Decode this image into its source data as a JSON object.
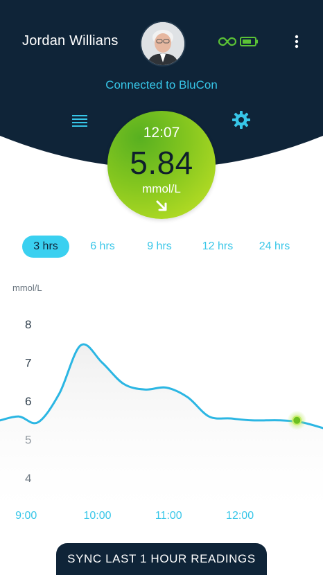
{
  "header": {
    "user_name": "Jordan Willians",
    "connection_status": "Connected to BluCon",
    "sensor_icon": "infinity-link-icon",
    "battery_icon": "battery-icon",
    "menu_icon": "menu-icon",
    "settings_icon": "gear-icon",
    "more_icon": "more-vertical-icon",
    "colors": {
      "background": "#0f2438",
      "accent": "#37c6e8",
      "status_green": "#5bc236"
    }
  },
  "reading": {
    "time": "12:07",
    "value": "5.84",
    "unit": "mmol/L",
    "trend_icon": "arrow-down-right-icon"
  },
  "range_tabs": [
    {
      "label": "3 hrs",
      "active": true
    },
    {
      "label": "6 hrs",
      "active": false
    },
    {
      "label": "9 hrs",
      "active": false
    },
    {
      "label": "12 hrs",
      "active": false
    },
    {
      "label": "24 hrs",
      "active": false
    }
  ],
  "chart_data": {
    "type": "line",
    "ylabel": "mmol/L",
    "ylim": [
      3.5,
      8.5
    ],
    "yticks": [
      8,
      7,
      6,
      5,
      4
    ],
    "xlim": [
      "8:38",
      "13:10"
    ],
    "xticks": [
      "9:00",
      "10:00",
      "11:00",
      "12:00"
    ],
    "grid": false,
    "series": [
      {
        "color": "#2bb6e3",
        "points": [
          {
            "x": "8:38",
            "y": 5.5
          },
          {
            "x": "8:54",
            "y": 5.6
          },
          {
            "x": "9:10",
            "y": 5.45
          },
          {
            "x": "9:28",
            "y": 6.2
          },
          {
            "x": "9:46",
            "y": 7.45
          },
          {
            "x": "10:04",
            "y": 7.0
          },
          {
            "x": "10:22",
            "y": 6.45
          },
          {
            "x": "10:40",
            "y": 6.3
          },
          {
            "x": "10:58",
            "y": 6.35
          },
          {
            "x": "11:16",
            "y": 6.1
          },
          {
            "x": "11:34",
            "y": 5.6
          },
          {
            "x": "11:52",
            "y": 5.55
          },
          {
            "x": "12:10",
            "y": 5.5
          },
          {
            "x": "12:34",
            "y": 5.5
          },
          {
            "x": "12:52",
            "y": 5.45
          },
          {
            "x": "13:10",
            "y": 5.3
          }
        ]
      }
    ],
    "current_point": {
      "x": "12:48",
      "y": 5.5
    }
  },
  "sync_button": {
    "label": "SYNC LAST 1 HOUR READINGS"
  }
}
